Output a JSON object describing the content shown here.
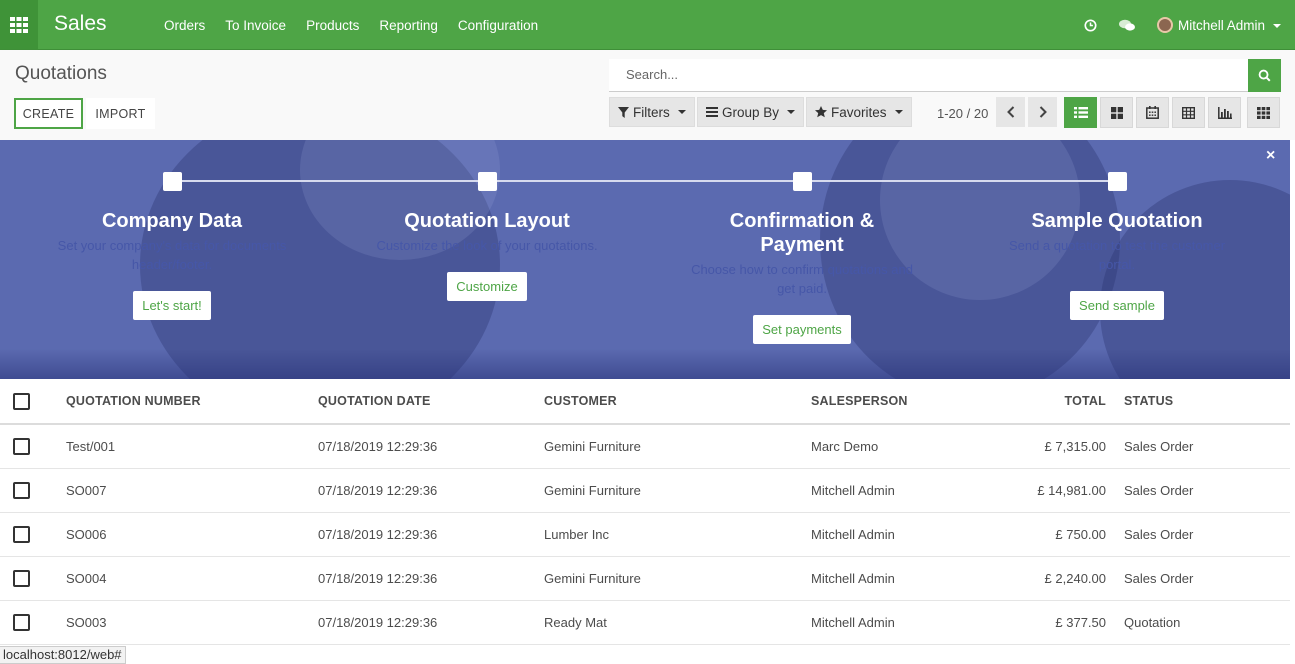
{
  "app": {
    "name": "Sales"
  },
  "menu": [
    "Orders",
    "To Invoice",
    "Products",
    "Reporting",
    "Configuration"
  ],
  "user": {
    "name": "Mitchell Admin"
  },
  "page": {
    "title": "Quotations"
  },
  "actions": {
    "create": "CREATE",
    "import": "IMPORT"
  },
  "search": {
    "placeholder": "Search..."
  },
  "filters": {
    "filters": "Filters",
    "group_by": "Group By",
    "favorites": "Favorites"
  },
  "pager": {
    "text": "1-20 / 20"
  },
  "onboarding": {
    "close": "×",
    "steps": [
      {
        "title": "Company Data",
        "desc": "Set your company's data for documents header/footer.",
        "button": "Let's start!"
      },
      {
        "title": "Quotation Layout",
        "desc": "Customize the look of your quotations.",
        "button": "Customize"
      },
      {
        "title": "Confirmation & Payment",
        "desc": "Choose how to confirm quotations and get paid.",
        "button": "Set payments"
      },
      {
        "title": "Sample Quotation",
        "desc": "Send a quotation to test the customer portal.",
        "button": "Send sample"
      }
    ]
  },
  "table": {
    "headers": {
      "number": "QUOTATION NUMBER",
      "date": "QUOTATION DATE",
      "customer": "CUSTOMER",
      "salesperson": "SALESPERSON",
      "total": "TOTAL",
      "status": "STATUS"
    },
    "rows": [
      {
        "number": "Test/001",
        "date": "07/18/2019 12:29:36",
        "customer": "Gemini Furniture",
        "salesperson": "Marc Demo",
        "total": "£ 7,315.00",
        "status": "Sales Order"
      },
      {
        "number": "SO007",
        "date": "07/18/2019 12:29:36",
        "customer": "Gemini Furniture",
        "salesperson": "Mitchell Admin",
        "total": "£ 14,981.00",
        "status": "Sales Order"
      },
      {
        "number": "SO006",
        "date": "07/18/2019 12:29:36",
        "customer": "Lumber Inc",
        "salesperson": "Mitchell Admin",
        "total": "£ 750.00",
        "status": "Sales Order"
      },
      {
        "number": "SO004",
        "date": "07/18/2019 12:29:36",
        "customer": "Gemini Furniture",
        "salesperson": "Mitchell Admin",
        "total": "£ 2,240.00",
        "status": "Sales Order"
      },
      {
        "number": "SO003",
        "date": "07/18/2019 12:29:36",
        "customer": "Ready Mat",
        "salesperson": "Mitchell Admin",
        "total": "£ 377.50",
        "status": "Quotation"
      }
    ]
  },
  "statusbar": {
    "url": "localhost:8012/web#"
  },
  "colors": {
    "brand": "#4ea546",
    "banner": "#5b6ab0"
  }
}
